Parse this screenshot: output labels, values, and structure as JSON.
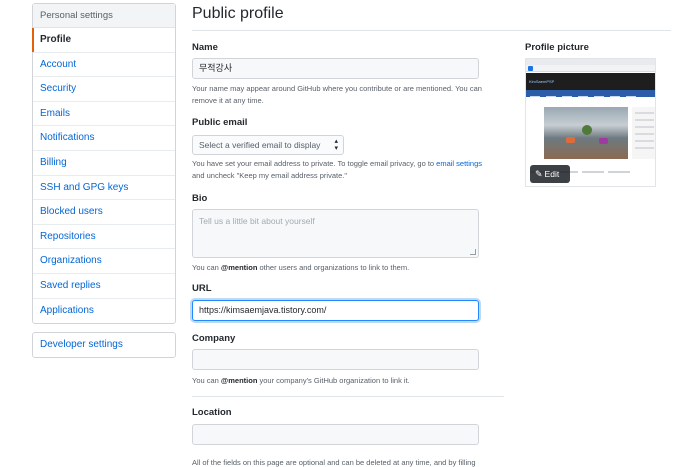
{
  "sidebar": {
    "header": "Personal settings",
    "items": [
      {
        "label": "Profile",
        "selected": true
      },
      {
        "label": "Account"
      },
      {
        "label": "Security"
      },
      {
        "label": "Emails"
      },
      {
        "label": "Notifications"
      },
      {
        "label": "Billing"
      },
      {
        "label": "SSH and GPG keys"
      },
      {
        "label": "Blocked users"
      },
      {
        "label": "Repositories"
      },
      {
        "label": "Organizations"
      },
      {
        "label": "Saved replies"
      },
      {
        "label": "Applications"
      }
    ],
    "developer_settings": "Developer settings"
  },
  "page": {
    "title": "Public profile"
  },
  "form": {
    "name": {
      "label": "Name",
      "value": "무적강사",
      "note": "Your name may appear around GitHub where you contribute or are mentioned. You can remove it at any time."
    },
    "public_email": {
      "label": "Public email",
      "selected": "Select a verified email to display",
      "note_before": "You have set your email address to private. To toggle email privacy, go to ",
      "note_link": "email settings",
      "note_after": "and uncheck \"Keep my email address private.\""
    },
    "bio": {
      "label": "Bio",
      "placeholder": "Tell us a little bit about yourself",
      "note_before": "You can ",
      "note_mention": "@mention",
      "note_after": " other users and organizations to link to them."
    },
    "url": {
      "label": "URL",
      "value": "https://kimsaemjava.tistory.com/"
    },
    "company": {
      "label": "Company",
      "value": "",
      "note_before": "You can ",
      "note_mention": "@mention",
      "note_after": " your company's GitHub organization to link it."
    },
    "location": {
      "label": "Location",
      "value": ""
    },
    "footer_note": "All of the fields on this page are optional and can be deleted at any time, and by filling"
  },
  "profile_picture": {
    "label": "Profile picture",
    "edit_label": "Edit",
    "screenshot_brand": "KimSaemPSP"
  },
  "colors": {
    "link": "#0366d6",
    "selected_marker": "#e36209",
    "focus_border": "#2188ff"
  }
}
